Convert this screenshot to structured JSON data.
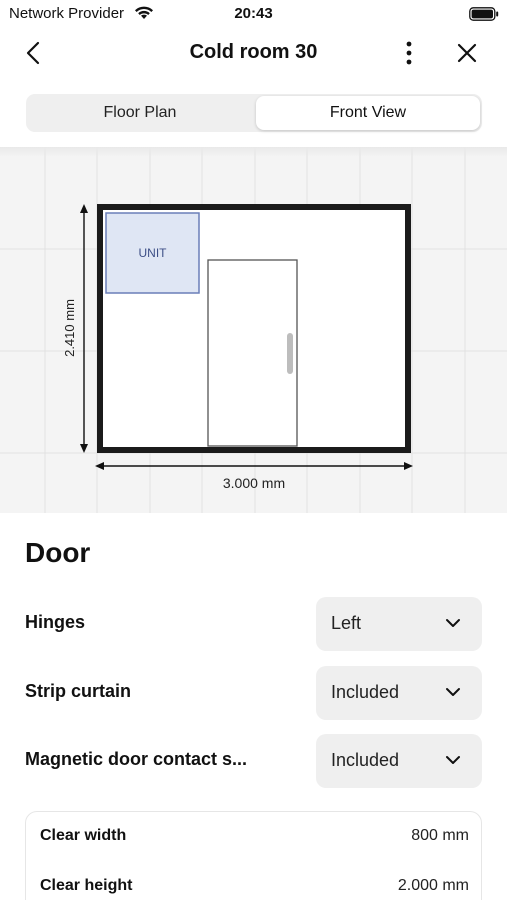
{
  "status_bar": {
    "carrier": "Network Provider",
    "time": "20:43"
  },
  "nav": {
    "title": "Cold room 30"
  },
  "tabs": [
    {
      "label": "Floor Plan",
      "selected": false
    },
    {
      "label": "Front View",
      "selected": true
    }
  ],
  "diagram": {
    "unit_label": "UNIT",
    "height_label": "2.410 mm",
    "width_label": "3.000 mm"
  },
  "door": {
    "title": "Door",
    "options": [
      {
        "label": "Hinges",
        "value": "Left"
      },
      {
        "label": "Strip curtain",
        "value": "Included"
      },
      {
        "label": "Magnetic door contact s...",
        "value": "Included"
      }
    ],
    "specs": [
      {
        "label": "Clear width",
        "value": "800 mm"
      },
      {
        "label": "Clear height",
        "value": "2.000 mm"
      }
    ]
  },
  "colors": {
    "unit_fill": "#dfe6f4",
    "unit_border": "#6a7fb8",
    "unit_text": "#3d4f86",
    "wall": "#1b1b1b"
  }
}
